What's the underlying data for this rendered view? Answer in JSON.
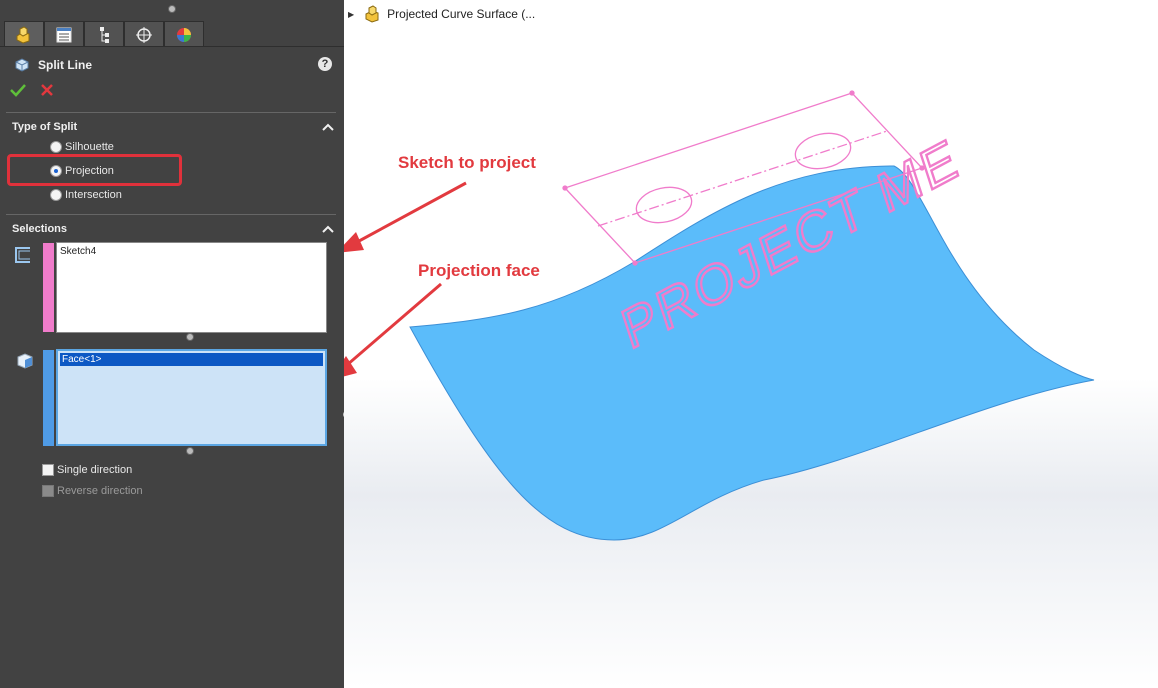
{
  "feature": {
    "title": "Split Line",
    "help_symbol": "?"
  },
  "type_of_split": {
    "title": "Type of Split",
    "options": [
      "Silhouette",
      "Projection",
      "Intersection"
    ],
    "selected": "Projection"
  },
  "selections": {
    "title": "Selections",
    "sketch_value": "Sketch4",
    "face_value": "Face<1>"
  },
  "options": {
    "single_direction": "Single direction",
    "reverse_direction": "Reverse direction"
  },
  "tree": {
    "item_label": "Projected Curve Surface (..."
  },
  "model": {
    "engraved_text": "PROJECT ME",
    "surface_color": "#5bbcfa",
    "sketch_color": "#f07ccb"
  },
  "callouts": {
    "sketch": "Sketch to project",
    "face": "Projection face"
  },
  "colors": {
    "callout": "#e23a3f",
    "panel_bg": "#424242",
    "selection_blue": "#0c58c4"
  }
}
